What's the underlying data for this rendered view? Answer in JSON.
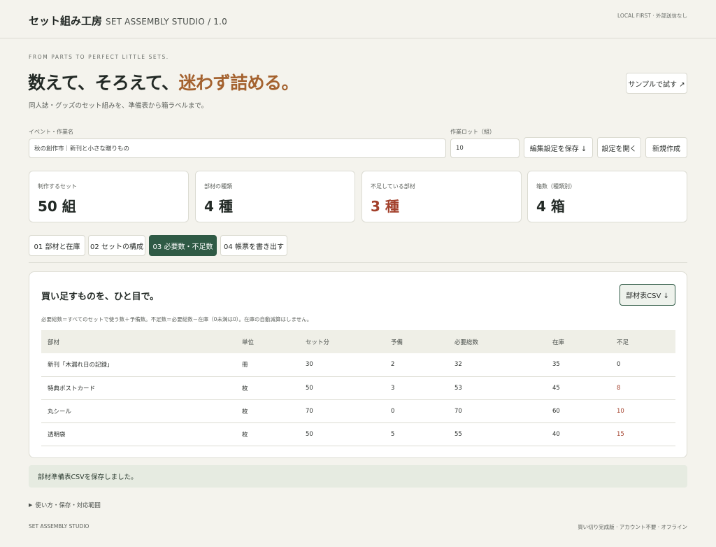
{
  "header": {
    "brand_jp": "セット組み工房",
    "brand_en": "SET ASSEMBLY STUDIO / 1.0",
    "badge": "LOCAL FIRST · 外部送信なし"
  },
  "hero": {
    "eyebrow": "FROM PARTS TO PERFECT LITTLE SETS.",
    "headline_main": "数えて、そろえて、",
    "headline_accent": "迷わず詰める。",
    "subline": "同人誌・グッズのセット組みを、準備表から箱ラベルまで。",
    "sample_button": "サンプルで試す ↗"
  },
  "form": {
    "event_label": "イベント・作業名",
    "event_value": "秋の創作市｜新刊と小さな贈りもの",
    "lot_label": "作業ロット（組）",
    "lot_value": "10",
    "save_settings": "編集設定を保存 ↓",
    "open_settings": "設定を開く",
    "new_job": "新規作成"
  },
  "stats": [
    {
      "label": "制作するセット",
      "value": "50 組"
    },
    {
      "label": "部材の種類",
      "value": "4 種"
    },
    {
      "label": "不足している部材",
      "value": "3 種"
    },
    {
      "label": "箱数（種類別）",
      "value": "4 箱"
    }
  ],
  "tabs": [
    {
      "label": "01 部材と在庫"
    },
    {
      "label": "02 セットの構成"
    },
    {
      "label": "03 必要数・不足数"
    },
    {
      "label": "04 帳票を書き出す"
    }
  ],
  "panel": {
    "title": "買い足すものを、ひと目で。",
    "csv_button": "部材表CSV ↓",
    "note": "必要総数＝すべてのセットで使う数＋予備数。不足数＝必要総数－在庫（0未満は0）。在庫の自動減算はしません。",
    "columns": [
      "部材",
      "単位",
      "セット分",
      "予備",
      "必要総数",
      "在庫",
      "不足"
    ],
    "rows": [
      [
        "新刊「木漏れ日の記録」",
        "冊",
        "30",
        "2",
        "32",
        "35",
        "0"
      ],
      [
        "特典ポストカード",
        "枚",
        "50",
        "3",
        "53",
        "45",
        "8"
      ],
      [
        "丸シール",
        "枚",
        "70",
        "0",
        "70",
        "60",
        "10"
      ],
      [
        "透明袋",
        "枚",
        "50",
        "5",
        "55",
        "40",
        "15"
      ]
    ]
  },
  "toast": "部材準備表CSVを保存しました。",
  "details_label": "使い方・保存・対応範囲",
  "footer": {
    "left": "SET ASSEMBLY STUDIO",
    "right": "買い切り完成版 · アカウント不要 · オフライン"
  },
  "colors": {
    "accent": "#a4622f",
    "primary": "#2f5a45",
    "alert": "#a3412c",
    "background": "#f4f3ed"
  }
}
